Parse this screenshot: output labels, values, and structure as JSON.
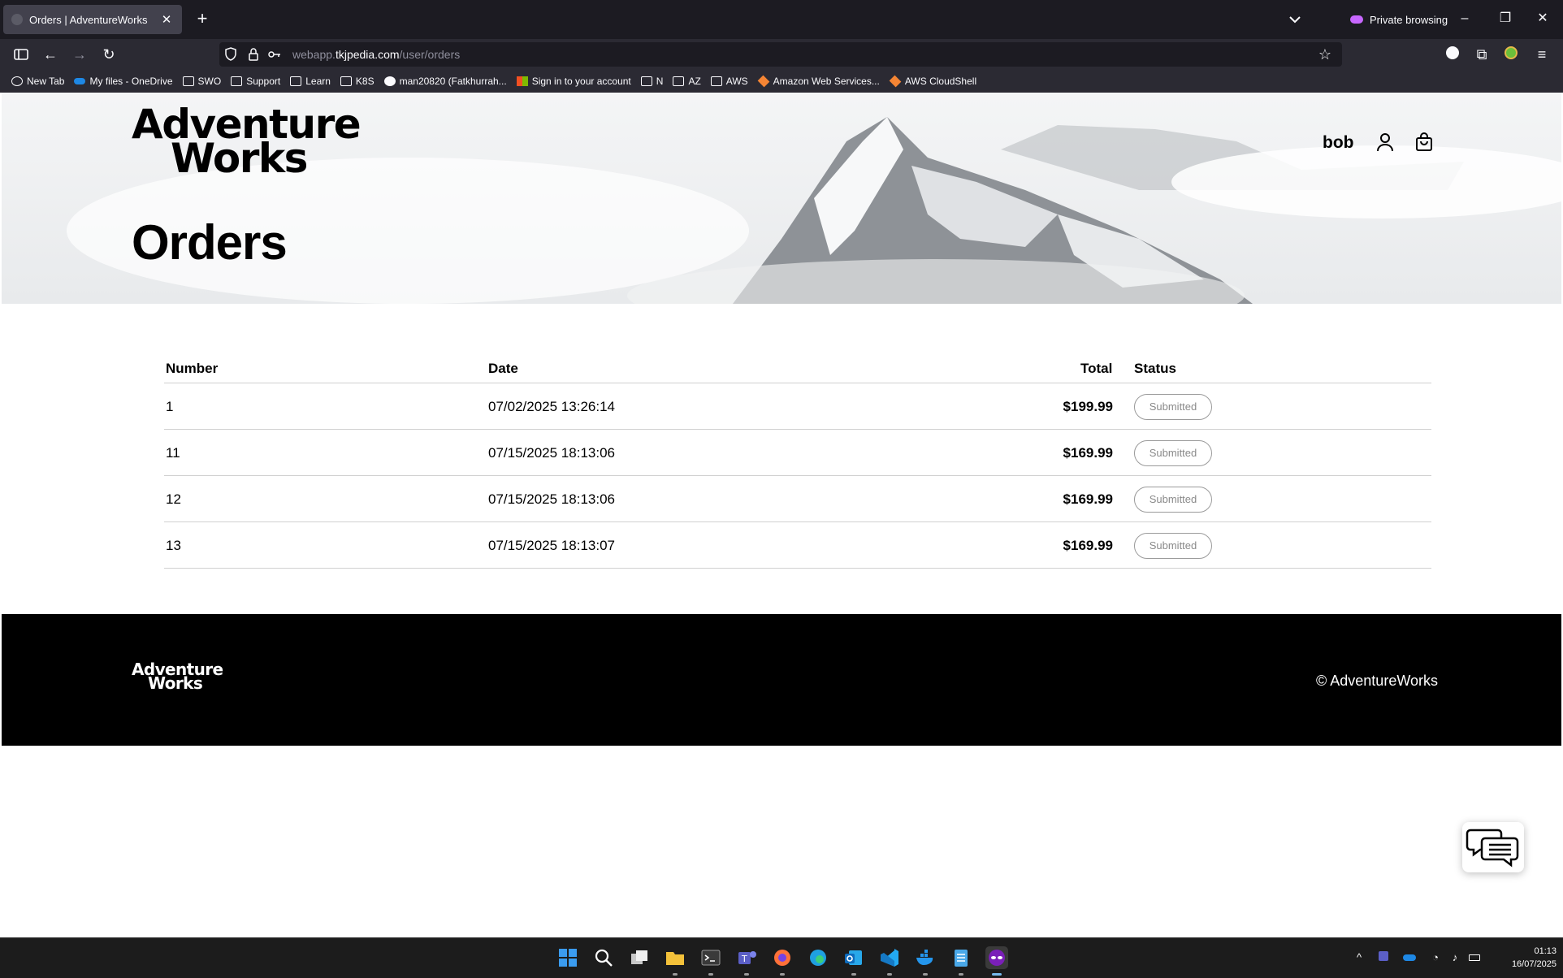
{
  "browser": {
    "tab_title": "Orders | AdventureWorks",
    "private_label": "Private browsing",
    "url_prefix": "webapp.",
    "url_host": "tkjpedia.com",
    "url_path": "/user/orders",
    "bookmarks": [
      {
        "label": "New Tab",
        "icon": "globe-icon"
      },
      {
        "label": "My files - OneDrive",
        "icon": "onedrive-icon"
      },
      {
        "label": "SWO",
        "icon": "folder-icon"
      },
      {
        "label": "Support",
        "icon": "folder-icon"
      },
      {
        "label": "Learn",
        "icon": "folder-icon"
      },
      {
        "label": "K8S",
        "icon": "folder-icon"
      },
      {
        "label": "man20820 (Fatkhurrah...",
        "icon": "github-icon"
      },
      {
        "label": "Sign in to your account",
        "icon": "microsoft-icon"
      },
      {
        "label": "N",
        "icon": "folder-icon"
      },
      {
        "label": "AZ",
        "icon": "folder-icon"
      },
      {
        "label": "AWS",
        "icon": "folder-icon"
      },
      {
        "label": "Amazon Web Services...",
        "icon": "aws-icon"
      },
      {
        "label": "AWS CloudShell",
        "icon": "aws-icon"
      }
    ]
  },
  "header": {
    "logo_line1": "Adventure",
    "logo_line2": "Works",
    "username": "bob",
    "page_title": "Orders"
  },
  "orders": {
    "columns": {
      "number": "Number",
      "date": "Date",
      "total": "Total",
      "status": "Status"
    },
    "rows": [
      {
        "number": "1",
        "date": "07/02/2025 13:26:14",
        "total": "$199.99",
        "status": "Submitted"
      },
      {
        "number": "11",
        "date": "07/15/2025 18:13:06",
        "total": "$169.99",
        "status": "Submitted"
      },
      {
        "number": "12",
        "date": "07/15/2025 18:13:06",
        "total": "$169.99",
        "status": "Submitted"
      },
      {
        "number": "13",
        "date": "07/15/2025 18:13:07",
        "total": "$169.99",
        "status": "Submitted"
      }
    ]
  },
  "footer": {
    "logo_line1": "Adventure",
    "logo_line2": "Works",
    "copyright": "© AdventureWorks"
  },
  "taskbar": {
    "time": "01:13",
    "date": "16/07/2025"
  },
  "colors": {
    "accent_private": "#c767ff",
    "chrome_dark": "#1c1b22",
    "footer_bg": "#000000"
  }
}
